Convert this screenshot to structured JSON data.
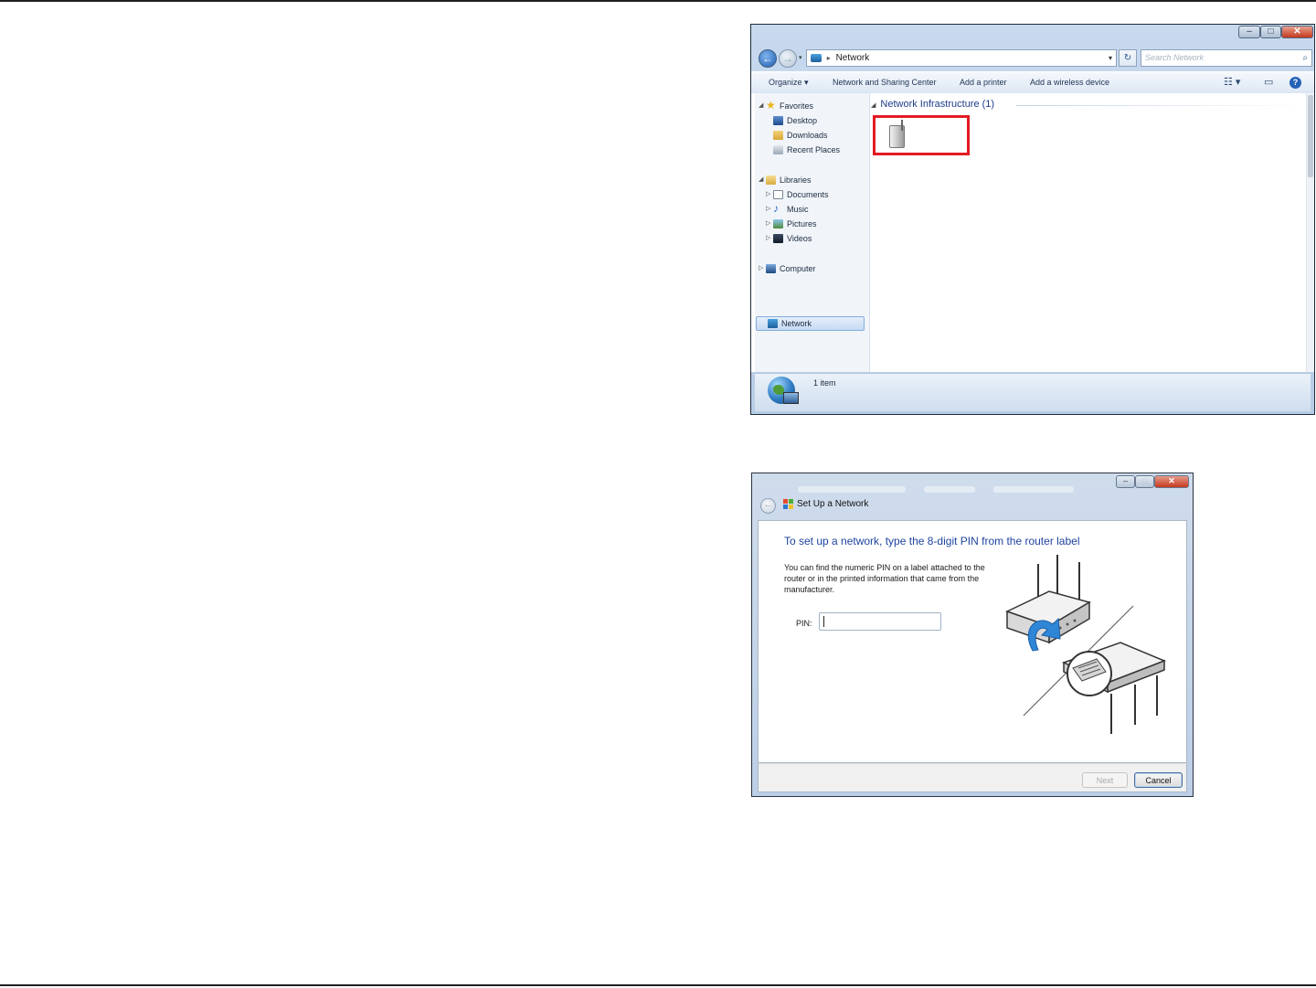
{
  "explorer": {
    "address": {
      "location": "Network"
    },
    "search_placeholder": "Search Network",
    "toolbar": {
      "organize": "Organize",
      "network_sharing": "Network and Sharing Center",
      "add_printer": "Add a printer",
      "add_wireless": "Add a wireless device"
    },
    "nav": {
      "favorites": "Favorites",
      "desktop": "Desktop",
      "downloads": "Downloads",
      "recent_places": "Recent Places",
      "libraries": "Libraries",
      "documents": "Documents",
      "music": "Music",
      "pictures": "Pictures",
      "videos": "Videos",
      "computer": "Computer",
      "network": "Network"
    },
    "group_header": "Network Infrastructure (1)",
    "status": "1 item"
  },
  "setup": {
    "title": "Set Up a Network",
    "heading": "To set up a network, type the 8-digit PIN from the router label",
    "description": "You can find the numeric PIN on a label attached to the router or in the printed information that came from the manufacturer.",
    "pin_label": "PIN:",
    "pin_value": "",
    "next": "Next",
    "cancel": "Cancel"
  },
  "colors": {
    "highlight_border": "#e31b23",
    "heading_blue": "#1e44a0",
    "arrow_blue": "#2f86d6"
  },
  "icons": [
    "back-arrow-icon",
    "forward-arrow-icon",
    "network-icon",
    "refresh-icon",
    "search-icon",
    "views-icon",
    "preview-pane-icon",
    "help-icon",
    "star-icon",
    "desktop-icon",
    "downloads-folder-icon",
    "recent-places-icon",
    "libraries-icon",
    "documents-icon",
    "music-icon",
    "pictures-icon",
    "videos-icon",
    "computer-icon",
    "router-device-icon",
    "network-globe-icon",
    "wireless-setup-icon"
  ]
}
